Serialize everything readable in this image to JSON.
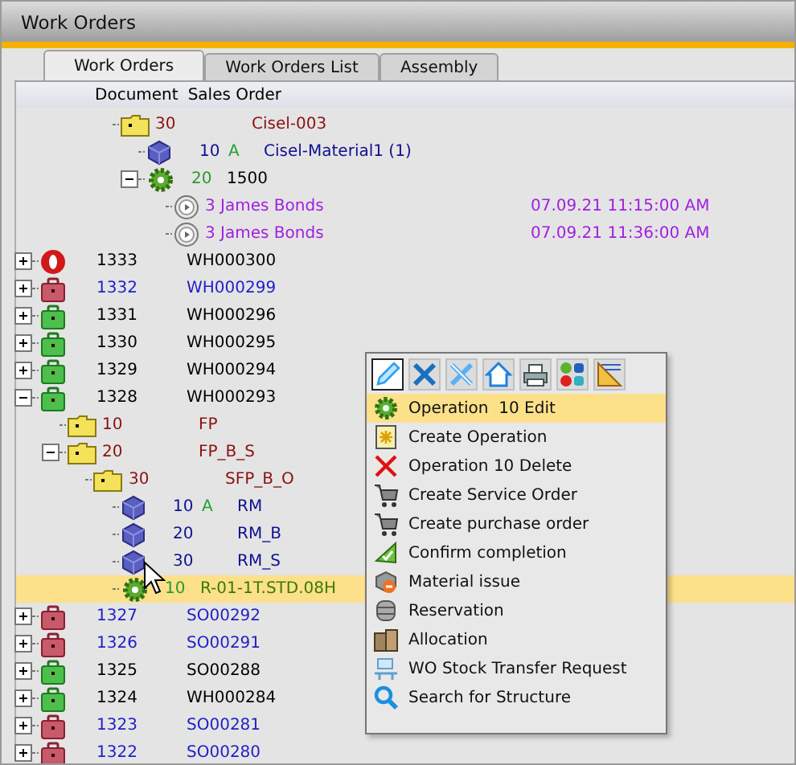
{
  "window": {
    "title": "Work Orders"
  },
  "tabs": [
    {
      "label": "Work Orders",
      "selected": true
    },
    {
      "label": "Work Orders List",
      "selected": false
    },
    {
      "label": "Assembly",
      "selected": false
    }
  ],
  "columns": [
    "Document",
    "Sales Order"
  ],
  "partial_branch": [
    {
      "kind": "folder",
      "number": "30",
      "name": "Cisel-003",
      "color": "#8b1010",
      "selected": false,
      "children": [
        {
          "kind": "material",
          "number": "10",
          "code": "A",
          "name": "Cisel-Material1 (1)",
          "color": "#101090",
          "selected": false
        },
        {
          "kind": "operation",
          "number": "20",
          "name": "1500",
          "color": "#000000",
          "expanded": true,
          "selected": false,
          "children": [
            {
              "kind": "resource",
              "name": "3 James Bonds",
              "datetime": "07.09.21 11:15:00 AM",
              "selected": false
            },
            {
              "kind": "resource",
              "name": "3 James Bonds",
              "datetime": "07.09.21 11:36:00 AM",
              "selected": false
            }
          ]
        }
      ]
    }
  ],
  "tree": [
    {
      "kind": "order_stop",
      "document": "1333",
      "sales_order": "WH000300",
      "color": "#000000",
      "expanded": false,
      "selected": false
    },
    {
      "kind": "order_red",
      "document": "1332",
      "sales_order": "WH000299",
      "color": "#2020c8",
      "expanded": false,
      "selected": false
    },
    {
      "kind": "order_green",
      "document": "1331",
      "sales_order": "WH000296",
      "color": "#000000",
      "expanded": false,
      "selected": false
    },
    {
      "kind": "order_green",
      "document": "1330",
      "sales_order": "WH000295",
      "color": "#000000",
      "expanded": false,
      "selected": false
    },
    {
      "kind": "order_green",
      "document": "1329",
      "sales_order": "WH000294",
      "color": "#000000",
      "expanded": false,
      "selected": false
    },
    {
      "kind": "order_green",
      "document": "1328",
      "sales_order": "WH000293",
      "color": "#000000",
      "expanded": true,
      "selected": false,
      "children": [
        {
          "kind": "folder",
          "number": "10",
          "name": "FP",
          "color": "#8b1010",
          "selected": false
        },
        {
          "kind": "folder",
          "number": "20",
          "name": "FP_B_S",
          "color": "#8b1010",
          "expanded": true,
          "selected": false,
          "children": [
            {
              "kind": "folder",
              "number": "30",
              "name": "SFP_B_O",
              "color": "#8b1010",
              "selected": false,
              "children": [
                {
                  "kind": "material",
                  "number": "10",
                  "code": "A",
                  "name": "RM",
                  "color": "#101090",
                  "selected": false
                },
                {
                  "kind": "material",
                  "number": "20",
                  "name": "RM_B",
                  "color": "#101090",
                  "selected": false
                },
                {
                  "kind": "material",
                  "number": "30",
                  "name": "RM_S",
                  "color": "#101090",
                  "selected": false
                },
                {
                  "kind": "operation",
                  "number": "10",
                  "name": "R-01-1T.STD.08H",
                  "color": "#3a7a00",
                  "selected": true
                }
              ]
            }
          ]
        }
      ]
    },
    {
      "kind": "order_red",
      "document": "1327",
      "sales_order": "SO00292",
      "color": "#2020c8",
      "expanded": false,
      "selected": false
    },
    {
      "kind": "order_red",
      "document": "1326",
      "sales_order": "SO00291",
      "color": "#2020c8",
      "expanded": false,
      "selected": false
    },
    {
      "kind": "order_green",
      "document": "1325",
      "sales_order": "SO00288",
      "color": "#000000",
      "expanded": false,
      "selected": false
    },
    {
      "kind": "order_green",
      "document": "1324",
      "sales_order": "WH000284",
      "color": "#000000",
      "expanded": false,
      "selected": false
    },
    {
      "kind": "order_red",
      "document": "1323",
      "sales_order": "SO00281",
      "color": "#2020c8",
      "expanded": false,
      "selected": false
    },
    {
      "kind": "order_red",
      "document": "1322",
      "sales_order": "SO00280",
      "color": "#2020c8",
      "expanded": false,
      "selected": false
    }
  ],
  "context_menu": {
    "toolbar": [
      {
        "kind": "pencil",
        "selected": true
      },
      {
        "kind": "tools",
        "selected": false
      },
      {
        "kind": "tools2",
        "selected": false
      },
      {
        "kind": "home",
        "selected": false
      },
      {
        "kind": "printer",
        "selected": false
      },
      {
        "kind": "people",
        "selected": false
      },
      {
        "kind": "ruler",
        "selected": false
      }
    ],
    "items": [
      {
        "kind": "gear",
        "label": "Operation  10 Edit",
        "selected": true
      },
      {
        "kind": "new",
        "label": "Create Operation",
        "selected": false
      },
      {
        "kind": "delete",
        "label": "Operation 10 Delete",
        "selected": false
      },
      {
        "kind": "cart",
        "label": "Create Service Order",
        "selected": false
      },
      {
        "kind": "cart",
        "label": "Create purchase order",
        "selected": false
      },
      {
        "kind": "confirm",
        "label": "Confirm completion",
        "selected": false
      },
      {
        "kind": "issue",
        "label": "Material issue",
        "selected": false
      },
      {
        "kind": "database",
        "label": "Reservation",
        "selected": false
      },
      {
        "kind": "boxes",
        "label": "Allocation",
        "selected": false
      },
      {
        "kind": "transfer",
        "label": "WO Stock Transfer Request",
        "selected": false
      },
      {
        "kind": "search",
        "label": "Search for Structure",
        "selected": false
      }
    ]
  }
}
